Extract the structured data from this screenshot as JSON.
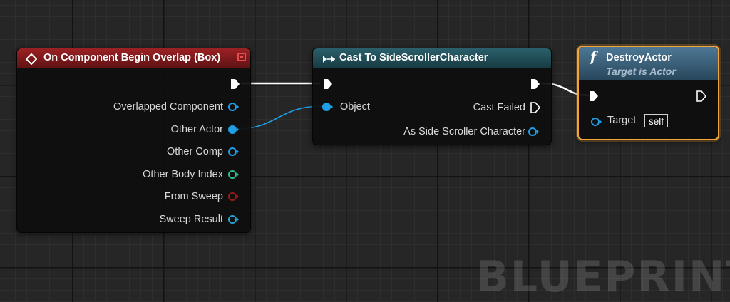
{
  "watermark": "BLUEPRINT",
  "colors": {
    "exec": "#ffffff",
    "object_pin": "#1e9fe8",
    "struct_pin": "#24a5d8",
    "int_pin": "#29c28b",
    "bool_pin": "#9b1b1b",
    "selection": "#f4a53a"
  },
  "nodes": {
    "overlap": {
      "title": "On Component Begin Overlap (Box)",
      "icon": "event-diamond-icon",
      "outputs": [
        {
          "label": "Overlapped Component",
          "type": "object",
          "connected": false
        },
        {
          "label": "Other Actor",
          "type": "object",
          "connected": true
        },
        {
          "label": "Other Comp",
          "type": "object",
          "connected": false
        },
        {
          "label": "Other Body Index",
          "type": "int",
          "connected": false
        },
        {
          "label": "From Sweep",
          "type": "bool",
          "connected": false
        },
        {
          "label": "Sweep Result",
          "type": "struct",
          "connected": false
        }
      ]
    },
    "cast": {
      "title": "Cast To SideScrollerCharacter",
      "icon": "cast-arrows-icon",
      "input_object": "Object",
      "cast_failed": "Cast Failed",
      "as_output": "As Side Scroller Character"
    },
    "destroy": {
      "title": "DestroyActor",
      "subtitle": "Target is Actor",
      "icon": "function-icon",
      "target_label": "Target",
      "target_value": "self"
    }
  }
}
